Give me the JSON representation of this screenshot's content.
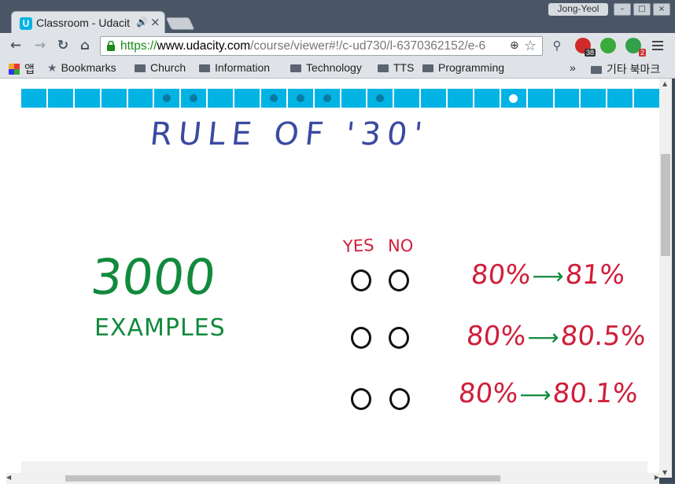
{
  "browser": {
    "tab_title": "Classroom - Udacit",
    "user_name": "Jong-Yeol",
    "url_scheme": "https://",
    "url_host": "www.udacity.com",
    "url_path": "/course/viewer#!/c-ud730/l-6370362152/e-6",
    "extensions": [
      {
        "name": "adblock-icon",
        "badge": "38",
        "color": "#d02a2a"
      },
      {
        "name": "evernote-icon",
        "badge": "",
        "color": "#3aaa3a"
      },
      {
        "name": "extension-icon",
        "badge": "2",
        "color": "#33a04a"
      }
    ]
  },
  "bookmarks": {
    "apps_label": "앱",
    "items": [
      "Bookmarks",
      "Church",
      "Information",
      "Technology",
      "TTS",
      "Programming"
    ],
    "overflow": "»",
    "other_label": "기타 북마크"
  },
  "lesson": {
    "progress_segments": 24,
    "dotted_segments": [
      5,
      6,
      9,
      10,
      11,
      13
    ],
    "current_segment": 18,
    "title": "RULE OF '30'",
    "big_number": "3000",
    "examples_label": "EXAMPLES",
    "yes_label": "YES",
    "no_label": "NO",
    "rows": [
      {
        "from": "80%",
        "to": "81%"
      },
      {
        "from": "80%",
        "to": "80.5%"
      },
      {
        "from": "80%",
        "to": "80.1%"
      }
    ]
  },
  "colors": {
    "accent": "#02b3e4",
    "ink_blue": "#3b4aa0",
    "ink_green": "#128a3e",
    "ink_red": "#d01e3a"
  }
}
